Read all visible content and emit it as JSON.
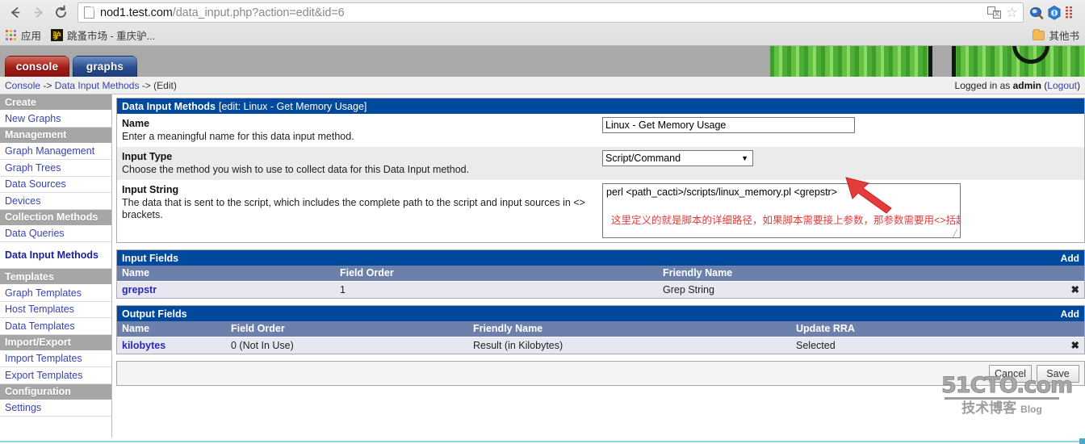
{
  "browser": {
    "back_icon": "back-arrow-icon",
    "forward_icon": "forward-arrow-icon",
    "reload_icon": "reload-icon",
    "url_host": "nod1.test.com",
    "url_path": "/data_input.php?action=edit&id=6",
    "translate_icon": "translate-icon",
    "bookmark_star_icon": "star-icon",
    "extension_1_icon": "magnifier-extension-icon",
    "extension_2_icon": "globe-extension-icon",
    "menu_icon": "chrome-menu-icon",
    "apps_label": "应用",
    "bookmark_1_label": "跳蚤市场 - 重庆驴...",
    "other_bookmarks_label": "其他书"
  },
  "banner": {
    "tabs": [
      {
        "label": "console",
        "active": true
      },
      {
        "label": "graphs",
        "active": false
      }
    ],
    "logo_name": "cacti-logo"
  },
  "topbar": {
    "breadcrumb": [
      {
        "label": "Console",
        "link": true
      },
      {
        "label": "->",
        "link": false
      },
      {
        "label": "Data Input Methods",
        "link": true
      },
      {
        "label": "->",
        "link": false
      },
      {
        "label": "(Edit)",
        "link": false
      }
    ],
    "logged_in_prefix": "Logged in as",
    "logged_in_user": "admin",
    "logout_open": "(",
    "logout_label": "Logout",
    "logout_close": ")"
  },
  "sidebar": {
    "sections": [
      {
        "header": "Create",
        "items": [
          {
            "label": "New Graphs",
            "active": false
          }
        ]
      },
      {
        "header": "Management",
        "items": [
          {
            "label": "Graph Management",
            "active": false
          },
          {
            "label": "Graph Trees",
            "active": false
          },
          {
            "label": "Data Sources",
            "active": false
          },
          {
            "label": "Devices",
            "active": false
          }
        ]
      },
      {
        "header": "Collection Methods",
        "items": [
          {
            "label": "Data Queries",
            "active": false
          },
          {
            "label": "Data Input Methods",
            "active": true
          }
        ]
      },
      {
        "header": "Templates",
        "items": [
          {
            "label": "Graph Templates",
            "active": false
          },
          {
            "label": "Host Templates",
            "active": false
          },
          {
            "label": "Data Templates",
            "active": false
          }
        ]
      },
      {
        "header": "Import/Export",
        "items": [
          {
            "label": "Import Templates",
            "active": false
          },
          {
            "label": "Export Templates",
            "active": false
          }
        ]
      },
      {
        "header": "Configuration",
        "items": [
          {
            "label": "Settings",
            "active": false
          }
        ]
      }
    ]
  },
  "form_panel": {
    "title": "Data Input Methods",
    "subtitle": "[edit: Linux - Get Memory Usage]",
    "rows": [
      {
        "label": "Name",
        "desc": "Enter a meaningful name for this data input method.",
        "control": "text",
        "value": "Linux - Get Memory Usage"
      },
      {
        "label": "Input Type",
        "desc": "Choose the method you wish to use to collect data for this Data Input method.",
        "control": "select",
        "value": "Script/Command"
      },
      {
        "label": "Input String",
        "desc": "The data that is sent to the script, which includes the complete path to the script and input sources in <> brackets.",
        "control": "textarea",
        "value": "perl <path_cacti>/scripts/linux_memory.pl <grepstr>",
        "annotation": "这里定义的就是脚本的详细路径，如果脚本需要接上参数，那参数需要用<>括起"
      }
    ]
  },
  "input_fields": {
    "title": "Input Fields",
    "add_label": "Add",
    "columns": [
      "Name",
      "Field Order",
      "Friendly Name",
      ""
    ],
    "rows": [
      {
        "name": "grepstr",
        "field_order": "1",
        "friendly_name": "Grep String",
        "delete": "✖"
      }
    ]
  },
  "output_fields": {
    "title": "Output Fields",
    "add_label": "Add",
    "columns": [
      "Name",
      "Field Order",
      "Friendly Name",
      "Update RRA",
      ""
    ],
    "rows": [
      {
        "name": "kilobytes",
        "field_order": "0 (Not In Use)",
        "friendly_name": "Result (in Kilobytes)",
        "update_rra": "Selected",
        "delete": "✖"
      }
    ]
  },
  "actions": {
    "cancel_label": "Cancel",
    "save_label": "Save"
  },
  "watermark": {
    "line1": "51CTO.com",
    "line2": "技术博客",
    "line3": "Blog"
  },
  "colors": {
    "panel_header": "#01499c",
    "table_header": "#6d80ab",
    "sidebar_header": "#a6a6a6",
    "link": "#3a43b0",
    "annotation_red": "#e23c3c",
    "tab_console": "#a11c15",
    "tab_graphs": "#2a4d8f"
  }
}
